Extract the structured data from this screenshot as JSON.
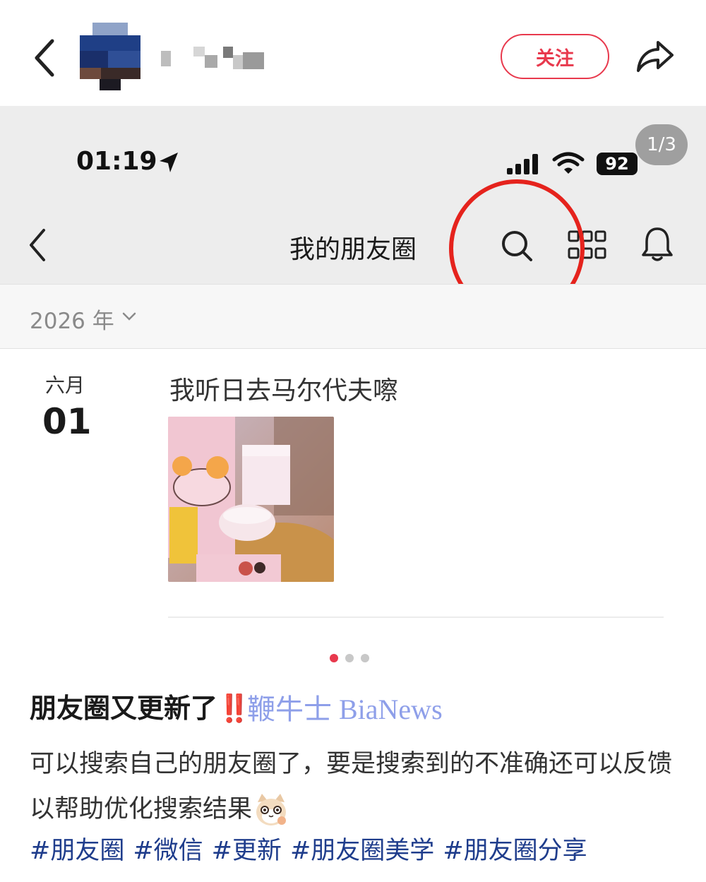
{
  "header": {
    "follow_label": "关注"
  },
  "screenshot": {
    "status": {
      "time": "01:19",
      "battery": "92",
      "page_indicator": "1/3"
    },
    "nav": {
      "title": "我的朋友圈"
    },
    "year_filter": "2026 年",
    "post": {
      "month": "六月",
      "day": "01",
      "text": "我听日去马尔代夫嚓"
    },
    "highlight_color": "#e5231d"
  },
  "pager": {
    "dot_count": 3,
    "active_index": 0,
    "active_color": "#e8394d"
  },
  "caption": {
    "title": "朋友圈又更新了",
    "title_marks": "‼️",
    "watermark": "鞭牛士 BiaNews",
    "body": "可以搜索自己的朋友圈了，要是搜索到的不准确还可以反馈以帮助优化搜索结果",
    "emoji": "cat-emoji",
    "tags": [
      "#朋友圈",
      "#微信",
      "#更新",
      "#朋友圈美学",
      "#朋友圈分享"
    ]
  },
  "colors": {
    "accent": "#e8394d",
    "tag": "#1f3d8c"
  }
}
